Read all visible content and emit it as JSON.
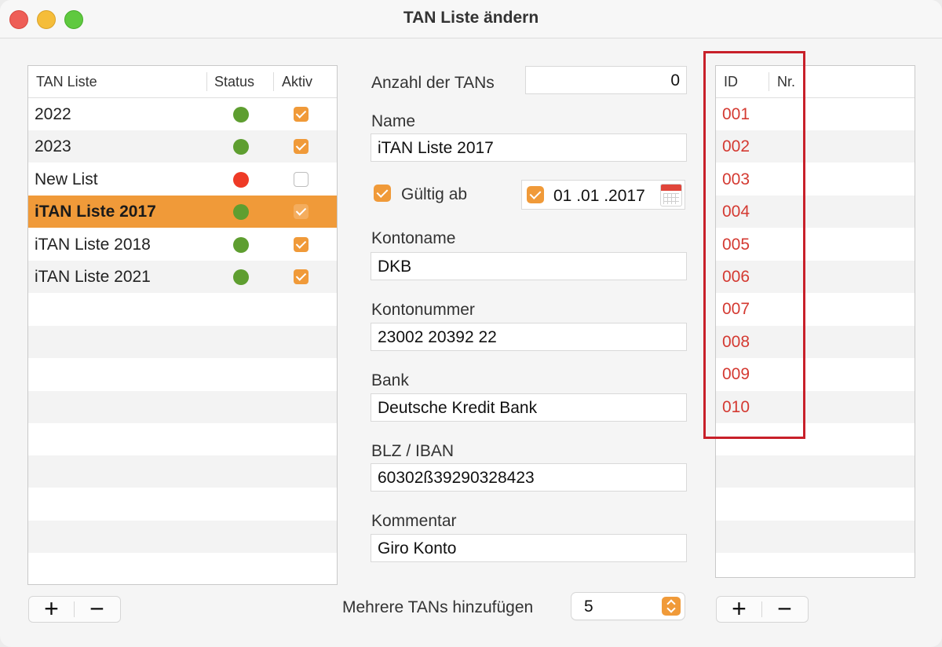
{
  "window": {
    "title": "TAN Liste ändern"
  },
  "left_table": {
    "headers": {
      "name": "TAN Liste",
      "status": "Status",
      "active": "Aktiv"
    },
    "rows": [
      {
        "name": "2022",
        "status_color": "#5e9e30",
        "active": true
      },
      {
        "name": "2023",
        "status_color": "#5e9e30",
        "active": true
      },
      {
        "name": "New List",
        "status_color": "#ee3a26",
        "active": false
      },
      {
        "name": "iTAN Liste 2017",
        "status_color": "#5e9e30",
        "active": true,
        "selected": true
      },
      {
        "name": "iTAN Liste 2018",
        "status_color": "#5e9e30",
        "active": true
      },
      {
        "name": "iTAN Liste 2021",
        "status_color": "#5e9e30",
        "active": true
      }
    ],
    "add_label": "+",
    "remove_label": "−"
  },
  "form": {
    "tan_count_label": "Anzahl der TANs",
    "tan_count_value": "0",
    "name_label": "Name",
    "name_value": "iTAN Liste 2017",
    "valid_from_label": "Gültig ab",
    "valid_from_checked": true,
    "date_checked": true,
    "date_value": "01 .01 .2017",
    "account_name_label": "Kontoname",
    "account_name_value": "DKB",
    "account_number_label": "Kontonummer",
    "account_number_value": "23002 20392 22",
    "bank_label": "Bank",
    "bank_value": "Deutsche Kredit Bank",
    "blz_label": "BLZ / IBAN",
    "blz_value": "60302ß39290328423",
    "comment_label": "Kommentar",
    "comment_value": "Giro Konto",
    "add_multiple_label": "Mehrere TANs hinzufügen",
    "add_multiple_value": "5"
  },
  "right_table": {
    "headers": {
      "id": "ID",
      "nr": "Nr."
    },
    "rows": [
      "001",
      "002",
      "003",
      "004",
      "005",
      "006",
      "007",
      "008",
      "009",
      "010"
    ],
    "add_label": "+",
    "remove_label": "−"
  },
  "colors": {
    "accent": "#f09a39",
    "highlight": "#c8202a",
    "id_text": "#d43a32"
  }
}
